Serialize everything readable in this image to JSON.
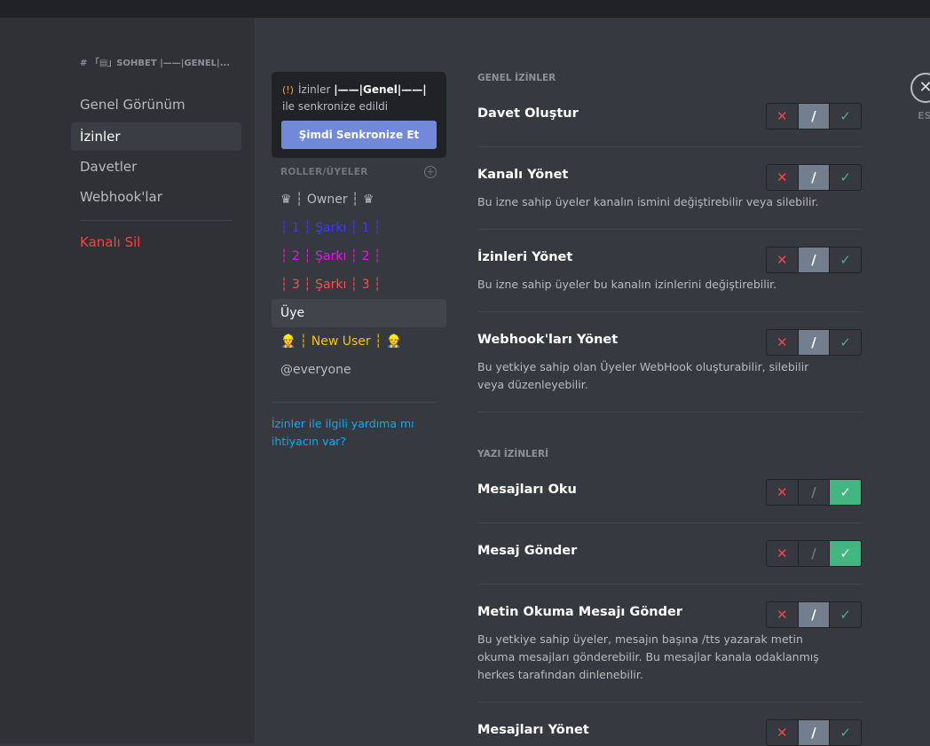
{
  "colors": {
    "accent": "#7289da",
    "deny": "#f04747",
    "allow": "#43b581",
    "neutral_selected": "#747f8d",
    "link": "#00b0f4"
  },
  "sidebar": {
    "header": "# 「▤」SOHBET |——|GENEL|...",
    "items": [
      {
        "label": "Genel Görünüm"
      },
      {
        "label": "İzinler"
      },
      {
        "label": "Davetler"
      },
      {
        "label": "Webhook'lar"
      }
    ],
    "delete_label": "Kanalı Sil"
  },
  "sync": {
    "warn_icon": "(!)",
    "text_prefix": "İzinler",
    "category": "|——|Genel|——|",
    "text_suffix": "ile senkronize edildi",
    "button": "Şimdi Senkronize Et"
  },
  "roles": {
    "header": "ROLLER/ÜYELER",
    "add_icon": "+",
    "items": [
      {
        "label": "♛ ┆ Owner ┆ ♛",
        "color": "#b9bbbe"
      },
      {
        "label": "┆ 1 ┆ Şarkı ┆ 1 ┆",
        "color": "#3b3bff"
      },
      {
        "label": "┆ 2 ┆ Şarkı ┆ 2 ┆",
        "color": "#e01bd8"
      },
      {
        "label": "┆ 3 ┆ Şarkı ┆ 3 ┆",
        "color": "#f05454"
      },
      {
        "label": "Üye",
        "color": "#ffffff"
      },
      {
        "label": "👷 ┆ New User ┆ 👷",
        "color": "#f1c40f"
      },
      {
        "label": "@everyone",
        "color": "#b9bbbe"
      }
    ]
  },
  "help_link": "İzinler ile ilgili yardıma mı ihtiyacın var?",
  "toggle_glyphs": {
    "deny": "✕",
    "neutral": "∕",
    "allow": "✓"
  },
  "sections": {
    "general": "GENEL İZİNLER",
    "text": "YAZI İZİNLERİ"
  },
  "permissions": [
    {
      "name": "Davet Oluştur",
      "desc": "",
      "state": "neutral"
    },
    {
      "name": "Kanalı Yönet",
      "desc": "Bu izne sahip üyeler kanalın ismini değiştirebilir veya silebilir.",
      "state": "neutral"
    },
    {
      "name": "İzinleri Yönet",
      "desc": "Bu izne sahip üyeler bu kanalın izinlerini değiştirebilir.",
      "state": "neutral"
    },
    {
      "name": "Webhook'ları Yönet",
      "desc": "Bu yetkiye sahip olan Üyeler WebHook oluşturabilir, silebilir veya düzenleyebilir.",
      "state": "neutral"
    },
    {
      "name": "Mesajları Oku",
      "desc": "",
      "state": "allow"
    },
    {
      "name": "Mesaj Gönder",
      "desc": "",
      "state": "allow"
    },
    {
      "name": "Metin Okuma Mesajı Gönder",
      "desc": "Bu yetkiye sahip üyeler, mesajın başına /tts yazarak metin okuma mesajları gönderebilir. Bu mesajlar kanala odaklanmış herkes tarafından dinlenebilir.",
      "state": "neutral"
    },
    {
      "name": "Mesajları Yönet",
      "desc": "",
      "state": "neutral"
    }
  ],
  "close": {
    "icon": "✕",
    "label": "ESC"
  }
}
